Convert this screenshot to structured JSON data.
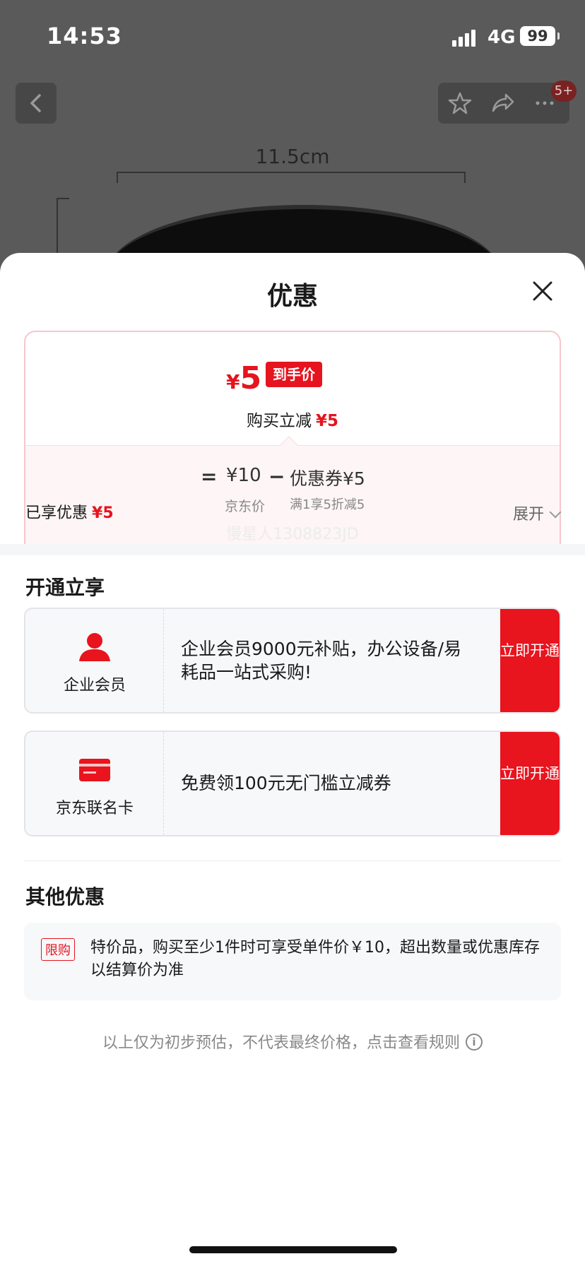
{
  "status_bar": {
    "time": "14:53",
    "network": "4G",
    "battery": "99"
  },
  "nav": {
    "badge": "5+"
  },
  "background": {
    "dimension_label": "11.5cm"
  },
  "sheet": {
    "title": "优惠",
    "price_card": {
      "currency": "¥",
      "final_price": "5",
      "final_tag": "到手价",
      "reduce_label": "购买立减",
      "reduce_value": "¥5",
      "equals": "=",
      "jd_price": "¥10",
      "jd_price_label": "京东价",
      "minus": "−",
      "coupon": "优惠券¥5",
      "coupon_desc": "满1享5折减5"
    },
    "enjoyed_label": "已享优惠",
    "enjoyed_value": "¥5",
    "expand_label": "展开",
    "watermark": "慢星人1308823JD",
    "open_section_title": "开通立享",
    "memberships": [
      {
        "name": "企业会员",
        "desc": "企业会员9000元补贴，办公设备/易耗品一站式采购!",
        "button": "立即开通"
      },
      {
        "name": "京东联名卡",
        "desc": "免费领100元无门槛立减券",
        "button": "立即开通"
      }
    ],
    "other_section_title": "其他优惠",
    "other": {
      "tag": "限购",
      "text": "特价品，购买至少1件时可享受单件价￥10，超出数量或优惠库存以结算价为准"
    },
    "footer": "以上仅为初步预估，不代表最终价格，点击查看规则"
  },
  "colors": {
    "accent": "#e5141e",
    "card_border": "#f6c7cc",
    "dim_bg": "#5a5a5a"
  }
}
